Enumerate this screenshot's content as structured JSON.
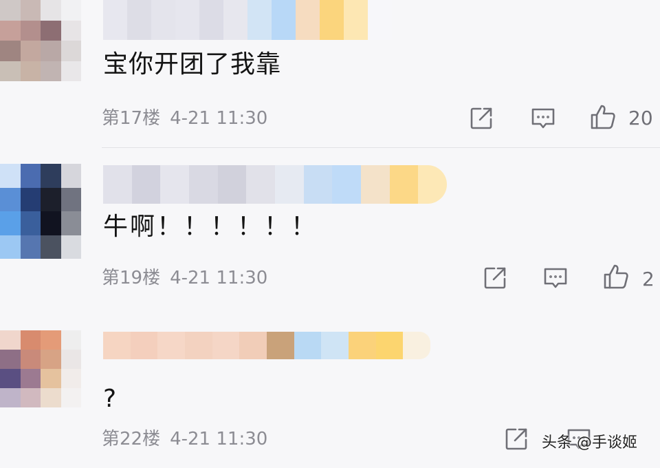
{
  "comments": [
    {
      "text": "宝你开团了我靠",
      "floor": "第17楼",
      "time": "4-21 11:30",
      "like_count": "20",
      "avatar_pixels": [
        "#cfc8c6",
        "#c9b9b5",
        "#e6e4e6",
        "#f1f1f3",
        "#c6a09a",
        "#b38f8d",
        "#8d6e73",
        "#e7e4e6",
        "#9f8581",
        "#c3a89f",
        "#b9a8a6",
        "#dcd8d8",
        "#c9bfb6",
        "#c8b3a6",
        "#c1b4b2",
        "#e9e7e9"
      ],
      "nick_pixels": [
        "#e7e7ef",
        "#dddde6",
        "#e4e4ec",
        "#e6e6ee",
        "#dcdce6",
        "#e7e7ee",
        "#d2e4f5",
        "#b8d8f7",
        "#f6dcc0",
        "#fbd57d",
        "#fde7b3",
        "#f7f7fa"
      ]
    },
    {
      "text": "牛啊！！！！！！",
      "floor": "第19楼",
      "time": "4-21 11:30",
      "like_count": "2",
      "avatar_pixels": [
        "#cfe1f7",
        "#4b6cb0",
        "#2e3d5c",
        "#d6d6dc",
        "#5a8fd6",
        "#253d73",
        "#1c1f2b",
        "#707380",
        "#5aa0e8",
        "#3a5f9c",
        "#111320",
        "#8a8d96",
        "#9cc8f3",
        "#5676b0",
        "#4b5260",
        "#d9dbe0"
      ],
      "nick_pixels": [
        "#e1e1ea",
        "#d2d2de",
        "#e5e5ed",
        "#d9d9e3",
        "#d1d1dc",
        "#e1e1e9",
        "#e6eaf2",
        "#c8ddf4",
        "#bfdbf8",
        "#f4e2c9",
        "#fcd887",
        "#fde8b6"
      ]
    },
    {
      "text": "?",
      "floor": "第22楼",
      "time": "4-21 11:30",
      "like_count": "",
      "avatar_pixels": [
        "#f0d6cc",
        "#d88b6e",
        "#e49b78",
        "#eeeeee",
        "#8e6f86",
        "#c98a7a",
        "#d7a385",
        "#eae6e6",
        "#5a4f82",
        "#9c7a91",
        "#e5c29e",
        "#f1ecea",
        "#bfb4c9",
        "#d1b9bf",
        "#ecdccd",
        "#f3f1f1"
      ],
      "nick_pixels": [
        "#f6d5c2",
        "#f4cfbd",
        "#f6d7c7",
        "#f3d2c0",
        "#f5d6c6",
        "#f1cdb8",
        "#c9a27a",
        "#b9d9f4",
        "#cfe4f5",
        "#fbd27a",
        "#fcd56f",
        "#f9f0e0"
      ]
    }
  ],
  "icons": {
    "share": "share-icon",
    "reply": "comment-icon",
    "like": "thumbs-up-icon"
  },
  "watermark": "头条 @手谈姬"
}
